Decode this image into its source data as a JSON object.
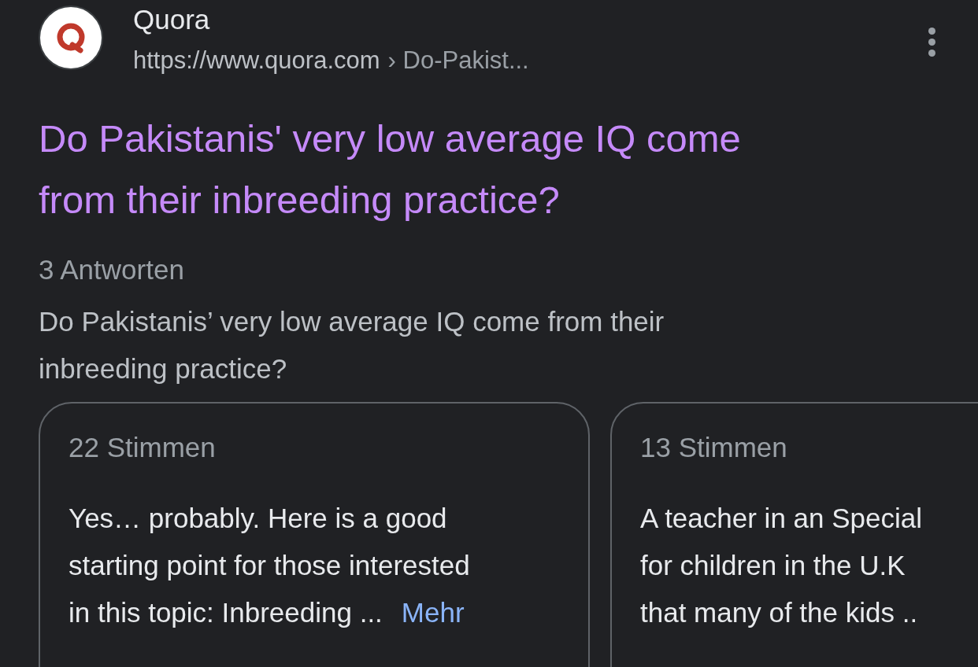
{
  "result": {
    "site_name": "Quora",
    "url": "https://www.quora.com",
    "breadcrumb": "› Do-Pakist...",
    "title_lines": [
      "Do Pakistanis' very low average IQ come",
      "from their inbreeding practice?"
    ],
    "answer_count": "3 Antworten",
    "snippet_lines": [
      "Do Pakistanis’ very low average IQ come from their",
      "inbreeding practice?"
    ]
  },
  "answers": [
    {
      "votes": "22 Stimmen",
      "lines": [
        "Yes… probably. Here is a good",
        "starting point for those interested",
        "in this topic: Inbreeding ..."
      ],
      "more": "Mehr"
    },
    {
      "votes": "13 Stimmen",
      "lines": [
        "A teacher in an Special",
        "for children in the U.K",
        "that many of the kids .."
      ]
    }
  ]
}
